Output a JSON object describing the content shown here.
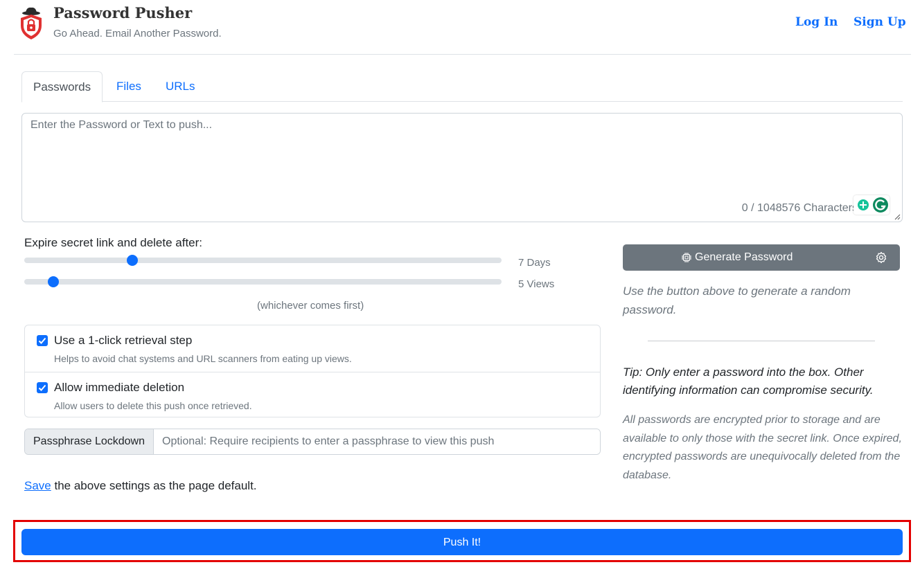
{
  "header": {
    "brand_title": "Password Pusher",
    "brand_tagline": "Go Ahead. Email Another Password.",
    "login": "Log In",
    "signup": "Sign Up"
  },
  "tabs": [
    {
      "label": "Passwords",
      "active": true
    },
    {
      "label": "Files",
      "active": false
    },
    {
      "label": "URLs",
      "active": false
    }
  ],
  "payload": {
    "placeholder": "Enter the Password or Text to push...",
    "char_count": "0 / 1048576 Characters"
  },
  "expire": {
    "label": "Expire secret link and delete after:",
    "days_value": "7 Days",
    "views_value": "5 Views",
    "days_fraction": 0.22,
    "views_fraction": 0.05,
    "whichever": "(whichever comes first)"
  },
  "options": [
    {
      "title": "Use a 1-click retrieval step",
      "desc": "Helps to avoid chat systems and URL scanners from eating up views.",
      "checked": true
    },
    {
      "title": "Allow immediate deletion",
      "desc": "Allow users to delete this push once retrieved.",
      "checked": true
    }
  ],
  "passphrase": {
    "label": "Passphrase Lockdown",
    "placeholder": "Optional: Require recipients to enter a passphrase to view this push"
  },
  "save": {
    "link": "Save",
    "rest": " the above settings as the page default."
  },
  "generator": {
    "button": "Generate Password",
    "hint": "Use the button above to generate a random password."
  },
  "tip": "Tip: Only enter a password into the box. Other identifying information can compromise security.",
  "info": "All passwords are encrypted prior to storage and are available to only those with the secret link. Once expired, encrypted passwords are unequivocally deleted from the database.",
  "push_button": "Push It!",
  "colors": {
    "primary": "#0d6efd",
    "secondary": "#6c757d",
    "highlight": "#e30000"
  }
}
